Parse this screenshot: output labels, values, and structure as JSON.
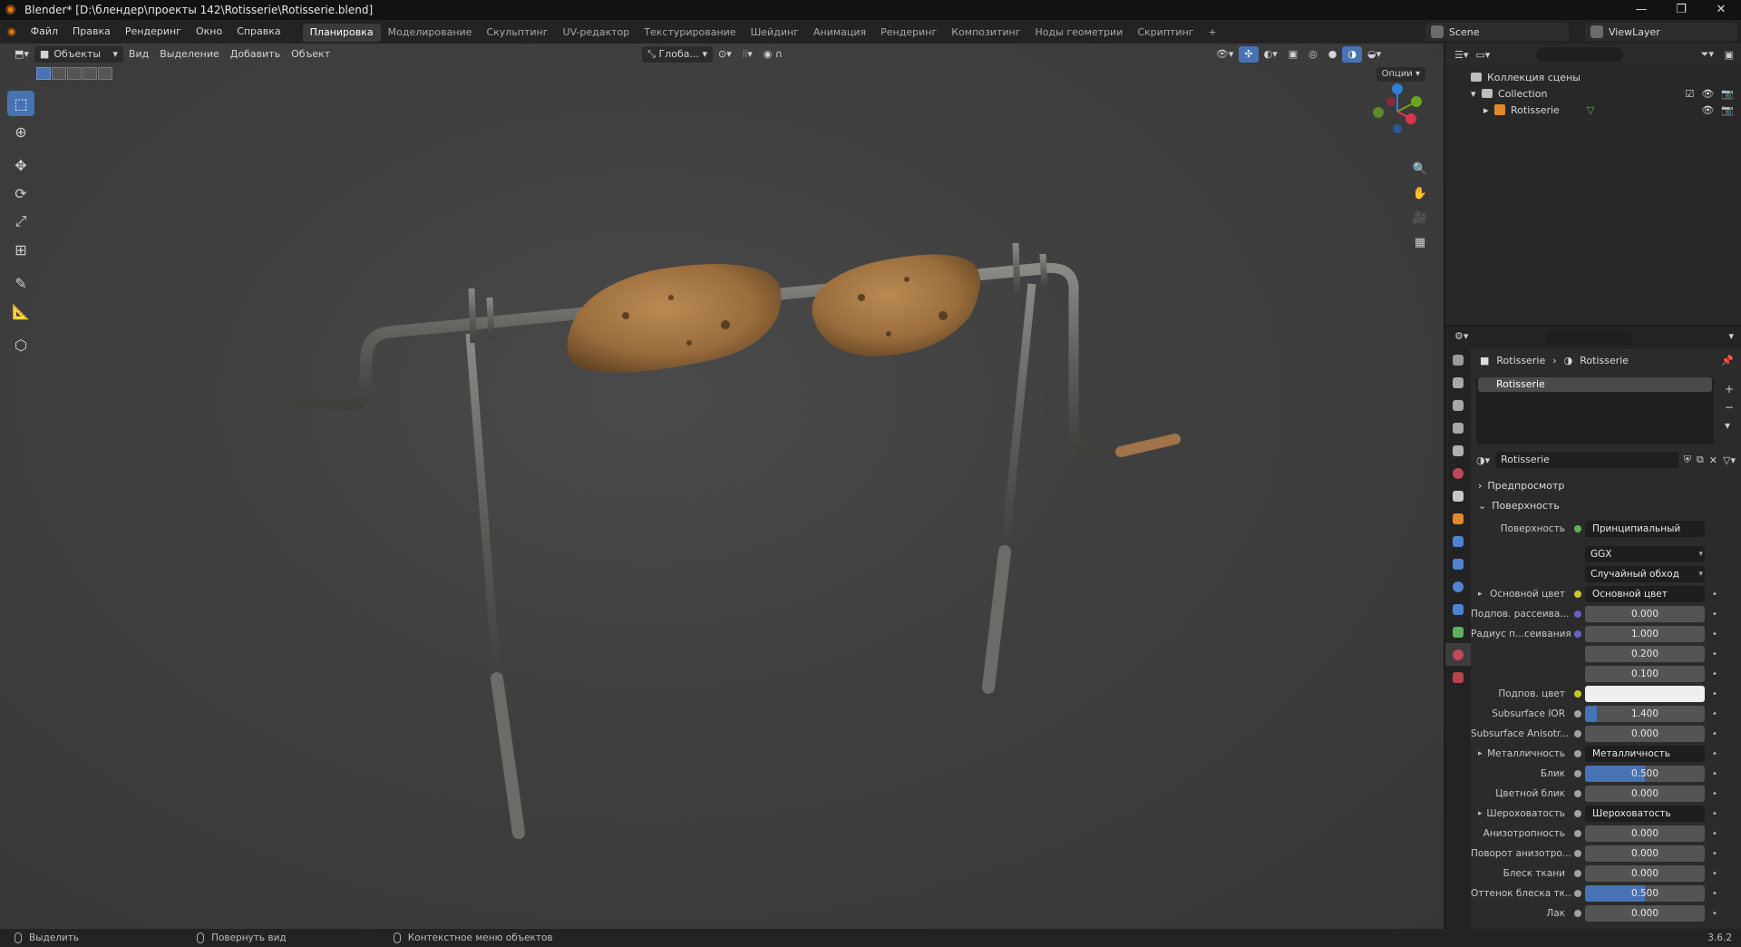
{
  "window": {
    "title": "Blender* [D:\\блендер\\проекты 142\\Rotisserie\\Rotisserie.blend]"
  },
  "menu": [
    "Файл",
    "Правка",
    "Рендеринг",
    "Окно",
    "Справка"
  ],
  "workspaces": [
    "Планировка",
    "Моделирование",
    "Скульптинг",
    "UV-редактор",
    "Текстурирование",
    "Шейдинг",
    "Анимация",
    "Рендеринг",
    "Композитинг",
    "Ноды геометрии",
    "Скриптинг"
  ],
  "scene": "Scene",
  "view_layer": "ViewLayer",
  "viewport": {
    "mode": "Объекты",
    "menus": [
      "Вид",
      "Выделение",
      "Добавить",
      "Объект"
    ],
    "orientation": "Глоба...",
    "options": "Опции"
  },
  "outliner": {
    "root": "Коллекция сцены",
    "collection": "Collection",
    "object": "Rotisserie"
  },
  "properties": {
    "breadcrumb": [
      "Rotisserie",
      "Rotisserie"
    ],
    "slot": "Rotisserie",
    "material": "Rotisserie",
    "panels": {
      "preview": "Предпросмотр",
      "surface": "Поверхность"
    },
    "surface_label": "Поверхность",
    "surface_value": "Принципиальный BSDF",
    "distribution": "GGX",
    "subsurface_method": "Случайный обход",
    "rows": [
      {
        "label": "Основной цвет",
        "value": "Основной цвет",
        "kind": "link",
        "sock": "#c7c729",
        "expand": true
      },
      {
        "label": "Подпов. рассеива...",
        "value": "0.000",
        "kind": "num",
        "sock": "#6363c7"
      },
      {
        "label": "Радиус п...сеивания",
        "value": "1.000",
        "kind": "num",
        "sock": "#6363c7"
      },
      {
        "label": "",
        "value": "0.200",
        "kind": "num",
        "sock": ""
      },
      {
        "label": "",
        "value": "0.100",
        "kind": "num",
        "sock": ""
      },
      {
        "label": "Подпов. цвет",
        "value": "",
        "kind": "color",
        "sock": "#c7c729"
      },
      {
        "label": "Subsurface IOR",
        "value": "1.400",
        "kind": "num",
        "sock": "#a1a1a1",
        "fill": 0.1
      },
      {
        "label": "Subsurface Anisotr...",
        "value": "0.000",
        "kind": "num",
        "sock": "#a1a1a1"
      },
      {
        "label": "Металличность",
        "value": "Металличность",
        "kind": "link",
        "sock": "#a1a1a1",
        "expand": true
      },
      {
        "label": "Блик",
        "value": "0.500",
        "kind": "num",
        "sock": "#a1a1a1",
        "fill": 0.5
      },
      {
        "label": "Цветной блик",
        "value": "0.000",
        "kind": "num",
        "sock": "#a1a1a1"
      },
      {
        "label": "Шероховатость",
        "value": "Шероховатость",
        "kind": "link",
        "sock": "#a1a1a1",
        "expand": true
      },
      {
        "label": "Анизотропность",
        "value": "0.000",
        "kind": "num",
        "sock": "#a1a1a1"
      },
      {
        "label": "Поворот анизотро...",
        "value": "0.000",
        "kind": "num",
        "sock": "#a1a1a1"
      },
      {
        "label": "Блеск ткани",
        "value": "0.000",
        "kind": "num",
        "sock": "#a1a1a1"
      },
      {
        "label": "Оттенок блеска тк...",
        "value": "0.500",
        "kind": "num",
        "sock": "#a1a1a1",
        "fill": 0.5
      },
      {
        "label": "Лак",
        "value": "0.000",
        "kind": "num",
        "sock": "#a1a1a1"
      }
    ]
  },
  "status": {
    "left": "Выделить",
    "mid": "Повернуть вид",
    "right": "Контекстное меню объектов",
    "version": "3.6.2"
  },
  "colors": {
    "accent": "#4772b3",
    "header": "#232323",
    "viewport": "#3f3f3f"
  }
}
